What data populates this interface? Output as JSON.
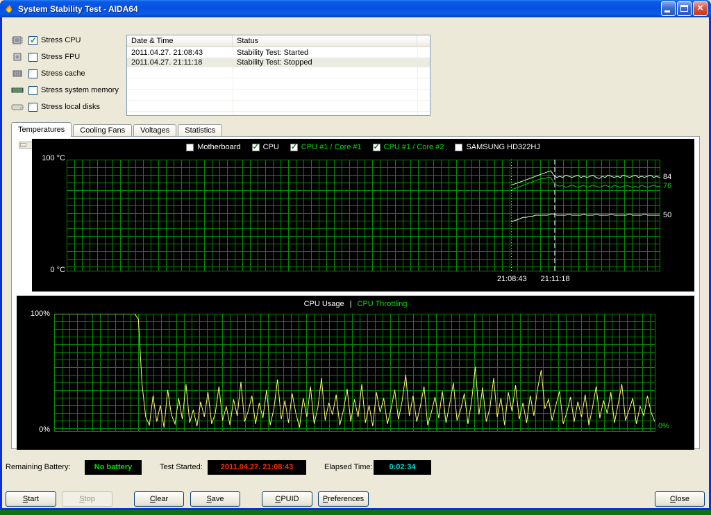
{
  "window": {
    "title": "System Stability Test - AIDA64"
  },
  "stress_options": {
    "items": [
      {
        "label": "Stress CPU",
        "checked": true
      },
      {
        "label": "Stress FPU",
        "checked": false
      },
      {
        "label": "Stress cache",
        "checked": false
      },
      {
        "label": "Stress system memory",
        "checked": false
      },
      {
        "label": "Stress local disks",
        "checked": false
      }
    ]
  },
  "log_table": {
    "columns": [
      "Date & Time",
      "Status"
    ],
    "rows": [
      {
        "datetime": "2011.04.27. 21:08:43",
        "status": "Stability Test: Started",
        "selected": false
      },
      {
        "datetime": "2011.04.27. 21:11:18",
        "status": "Stability Test: Stopped",
        "selected": true
      }
    ]
  },
  "tabs": [
    {
      "label": "Temperatures",
      "active": true
    },
    {
      "label": "Cooling Fans",
      "active": false
    },
    {
      "label": "Voltages",
      "active": false
    },
    {
      "label": "Statistics",
      "active": false
    }
  ],
  "chart_data": [
    {
      "id": "temperatures",
      "type": "line",
      "y_axis": {
        "min": 0,
        "max": 100,
        "max_label": "100 °C",
        "min_label": "0 °C"
      },
      "x_ticks": [
        {
          "label": "21:08:43",
          "frac": 0.75
        },
        {
          "label": "21:11:18",
          "frac": 0.823
        }
      ],
      "markers": [
        {
          "frac": 0.75,
          "style": "dotted"
        },
        {
          "frac": 0.823,
          "style": "dashed"
        }
      ],
      "legend": [
        {
          "label": "Motherboard",
          "checked": false,
          "color": "#ffffff"
        },
        {
          "label": "CPU",
          "checked": true,
          "color": "#ffffff"
        },
        {
          "label": "CPU #1 / Core #1",
          "checked": true,
          "color": "#00e000"
        },
        {
          "label": "CPU #1 / Core #2",
          "checked": true,
          "color": "#00e000"
        },
        {
          "label": "SAMSUNG HD322HJ",
          "checked": false,
          "color": "#ffffff"
        }
      ],
      "series": [
        {
          "name": "CPU #1 / Core #1",
          "color": "#d0ffd0",
          "start_frac": 0.75,
          "end_label": "84",
          "end_label_color": "#ffffff",
          "values": [
            77,
            78,
            79,
            80,
            81,
            82,
            83,
            84,
            85,
            86,
            87,
            88,
            89,
            90,
            86,
            84,
            85,
            84,
            86,
            85,
            84,
            85,
            86,
            84,
            85,
            84,
            85,
            86,
            84,
            83,
            85,
            84,
            86,
            85,
            84,
            85,
            84,
            86,
            85,
            84,
            85,
            86,
            84,
            85,
            84,
            85,
            86,
            84,
            85,
            84
          ]
        },
        {
          "name": "CPU #1 / Core #2",
          "color": "#00cc00",
          "start_frac": 0.75,
          "end_label": "76",
          "end_label_color": "#00e000",
          "values": [
            73,
            74,
            75,
            76,
            77,
            78,
            79,
            80,
            81,
            82,
            83,
            83,
            84,
            84,
            79,
            77,
            76,
            77,
            75,
            76,
            77,
            76,
            75,
            76,
            77,
            75,
            76,
            77,
            76,
            75,
            76,
            77,
            76,
            75,
            77,
            76,
            75,
            76,
            77,
            76,
            75,
            76,
            75,
            77,
            76,
            75,
            76,
            77,
            76,
            76
          ]
        },
        {
          "name": "CPU",
          "color": "#e8ffe8",
          "start_frac": 0.75,
          "end_label": "50",
          "end_label_color": "#ffffff",
          "values": [
            44,
            45,
            46,
            47,
            48,
            48,
            49,
            49,
            50,
            50,
            50,
            50,
            50,
            51,
            51,
            50,
            50,
            50,
            50,
            51,
            50,
            50,
            50,
            50,
            51,
            50,
            50,
            50,
            51,
            50,
            50,
            50,
            50,
            51,
            50,
            50,
            50,
            50,
            50,
            51,
            50,
            50,
            50,
            50,
            51,
            50,
            50,
            50,
            50,
            50
          ]
        }
      ]
    },
    {
      "id": "cpu_usage",
      "type": "line",
      "title_parts": [
        {
          "text": "CPU Usage",
          "color": "#ffffff"
        },
        {
          "text": "|",
          "color": "#ffffff"
        },
        {
          "text": "CPU Throttling",
          "color": "#00e000"
        }
      ],
      "y_axis": {
        "min": 0,
        "max": 100,
        "max_label": "100%",
        "min_label": "0%"
      },
      "right_label": {
        "text": "0%",
        "color": "#00e000"
      },
      "series": [
        {
          "name": "CPU Usage",
          "color": "#ffff70",
          "start_frac": 0,
          "values": [
            100,
            100,
            100,
            100,
            100,
            100,
            100,
            100,
            100,
            100,
            100,
            100,
            100,
            100,
            100,
            100,
            100,
            100,
            100,
            100,
            100,
            100,
            100,
            95,
            40,
            12,
            5,
            30,
            8,
            22,
            3,
            35,
            14,
            6,
            28,
            10,
            40,
            7,
            18,
            4,
            25,
            12,
            33,
            6,
            15,
            38,
            9,
            21,
            5,
            27,
            13,
            42,
            8,
            17,
            30,
            6,
            24,
            11,
            35,
            5,
            19,
            44,
            10,
            26,
            7,
            32,
            15,
            3,
            28,
            12,
            38,
            6,
            20,
            45,
            9,
            24,
            14,
            31,
            5,
            18,
            36,
            8,
            27,
            12,
            40,
            7,
            22,
            4,
            33,
            16,
            28,
            6,
            19,
            35,
            10,
            25,
            48,
            13,
            30,
            8,
            21,
            38,
            5,
            16,
            29,
            11,
            34,
            7,
            23,
            41,
            9,
            18,
            32,
            6,
            26,
            55,
            14,
            37,
            8,
            20,
            45,
            12,
            28,
            5,
            33,
            17,
            39,
            10,
            24,
            7,
            30,
            13,
            36,
            52,
            19,
            27,
            9,
            22,
            34,
            6,
            16,
            29,
            8,
            25,
            12,
            31,
            5,
            20,
            38,
            11,
            26,
            15,
            33,
            7,
            23,
            40,
            9,
            18,
            28,
            6,
            21,
            13,
            30,
            16,
            8
          ]
        }
      ]
    }
  ],
  "status_bar": {
    "remaining_battery_label": "Remaining Battery:",
    "remaining_battery_value": "No battery",
    "remaining_battery_color": "#00dd00",
    "test_started_label": "Test Started:",
    "test_started_value": "2011.04.27. 21:08:43",
    "test_started_color": "#ff2a00",
    "elapsed_time_label": "Elapsed Time:",
    "elapsed_time_value": "0:02:34",
    "elapsed_time_color": "#00dddd"
  },
  "buttons": [
    {
      "label": "Start",
      "enabled": true
    },
    {
      "label": "Stop",
      "enabled": false
    },
    {
      "label": "Clear",
      "enabled": true
    },
    {
      "label": "Save",
      "enabled": true
    },
    {
      "label": "CPUID",
      "enabled": true
    },
    {
      "label": "Preferences",
      "enabled": true
    },
    {
      "label": "Close",
      "enabled": true
    }
  ]
}
